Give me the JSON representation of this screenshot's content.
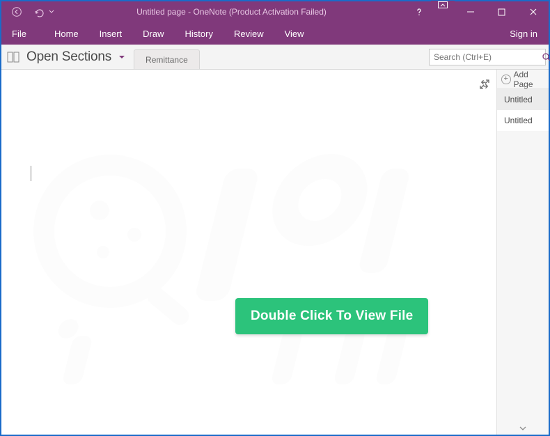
{
  "titlebar": {
    "title": "Untitled page - OneNote (Product Activation Failed)"
  },
  "ribbon": {
    "file": "File",
    "tabs": [
      "Home",
      "Insert",
      "Draw",
      "History",
      "Review",
      "View"
    ],
    "signin": "Sign in"
  },
  "sectionbar": {
    "notebook_label": "Open Sections",
    "section_tab": "Remittance",
    "search_placeholder": "Search (Ctrl+E)"
  },
  "canvas": {
    "view_button": "Double Click To View File"
  },
  "rightpane": {
    "add_label": "Add Page",
    "pages": [
      "Untitled",
      "Untitled"
    ]
  },
  "colors": {
    "accent": "#80397b",
    "window_border": "#1a6bc9",
    "cta": "#2cc37b"
  }
}
